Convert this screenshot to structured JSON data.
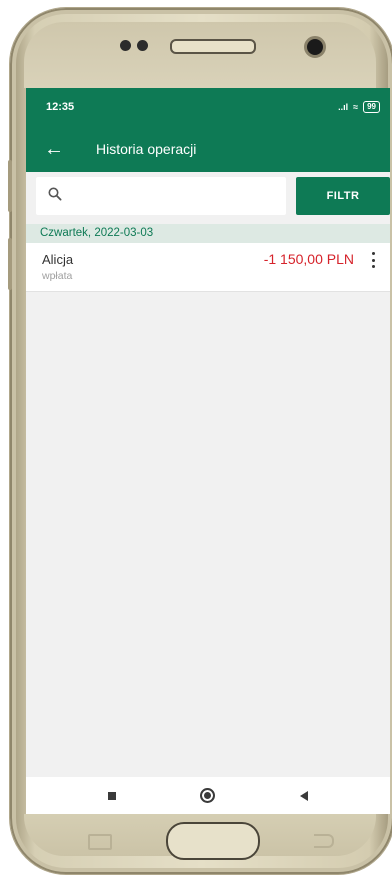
{
  "status_bar": {
    "time": "12:35",
    "signal": "..ıl",
    "wifi": "≈",
    "battery": "99"
  },
  "app_bar": {
    "back_icon": "←",
    "title": "Historia operacji"
  },
  "search": {
    "icon": "⌕",
    "placeholder": "",
    "value": ""
  },
  "filter": {
    "label": "FILTR"
  },
  "transactions": {
    "date_header": "Czwartek, 2022-03-03",
    "items": [
      {
        "name": "Alicja",
        "type": "wpłata",
        "amount": "-1 150,00 PLN"
      }
    ]
  },
  "colors": {
    "brand_green": "#0e7a55",
    "negative_amount": "#d6232b",
    "date_header_bg": "#dde9e3"
  },
  "icons": [
    "sensor-dots-icon",
    "speaker-icon",
    "front-camera-icon",
    "back-arrow-icon",
    "search-icon",
    "more-vertical-icon",
    "recent-apps-icon",
    "home-icon",
    "back-icon"
  ]
}
